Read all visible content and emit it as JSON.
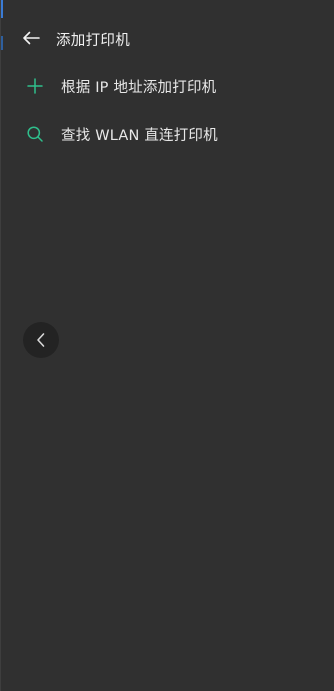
{
  "header": {
    "title": "添加打印机",
    "back_icon": "arrow-left-icon"
  },
  "menu": {
    "items": [
      {
        "icon": "plus-icon",
        "label": "根据 IP 地址添加打印机"
      },
      {
        "icon": "search-icon",
        "label": "查找 WLAN 直连打印机"
      }
    ]
  },
  "side_handle": {
    "icon": "chevron-left-icon"
  },
  "colors": {
    "background": "#303030",
    "accent": "#2fbf8c",
    "text": "#e8e8e8"
  }
}
